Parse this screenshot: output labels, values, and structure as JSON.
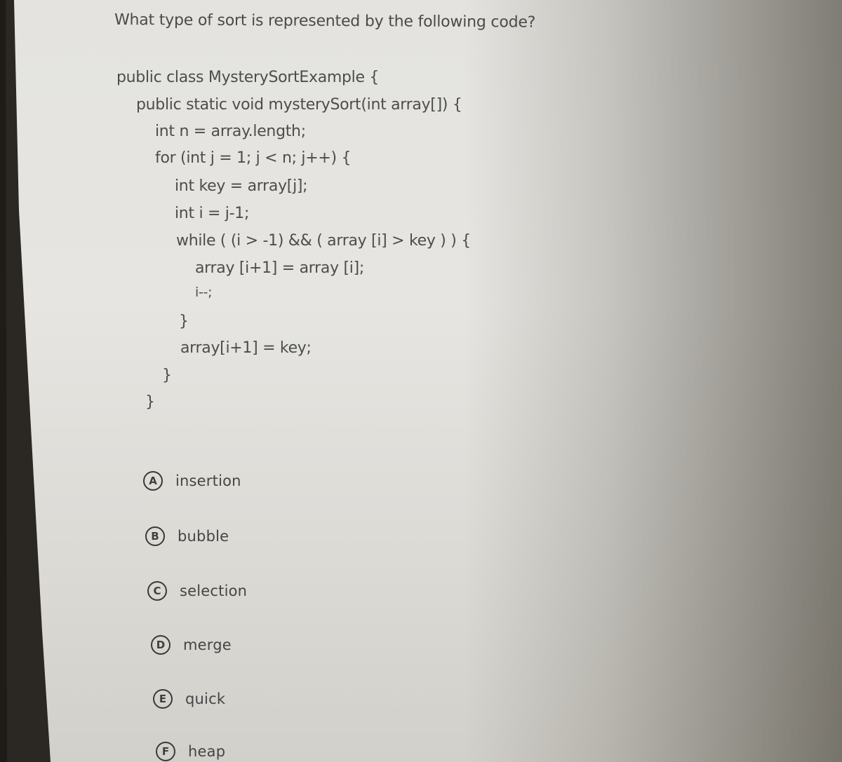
{
  "question": {
    "text": "What type of sort is represented by the following code?"
  },
  "code": {
    "lines": [
      "public class MysterySortExample {",
      "public static void mysterySort(int array[]) {",
      "int n = array.length;",
      "for (int j = 1; j < n; j++) {",
      "int key = array[j];",
      "int i = j-1;",
      "while ( (i > -1) && ( array [i] > key ) ) {",
      "array [i+1] = array [i];",
      "i--;",
      "}",
      "array[i+1] = key;",
      "}",
      "}"
    ]
  },
  "options": [
    {
      "letter": "A",
      "label": "insertion"
    },
    {
      "letter": "B",
      "label": "bubble"
    },
    {
      "letter": "C",
      "label": "selection"
    },
    {
      "letter": "D",
      "label": "merge"
    },
    {
      "letter": "E",
      "label": "quick"
    },
    {
      "letter": "F",
      "label": "heap"
    }
  ],
  "colors": {
    "text": "#4a4a4a",
    "badge_border": "#3a3a3a",
    "screen_bg": "#e4e3df",
    "bezel": "#2b2723"
  }
}
